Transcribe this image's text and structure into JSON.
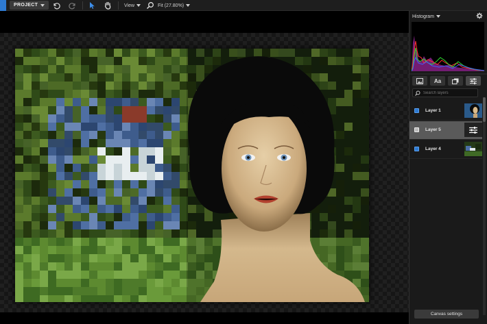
{
  "toolbar": {
    "project_label": "PROJECT",
    "view_label": "View",
    "zoom_label": "Fit (27.80%)",
    "icons": [
      "undo-icon",
      "redo-icon",
      "pointer-icon",
      "hand-icon",
      "zoom-icon"
    ]
  },
  "panel": {
    "histogram_label": "Histogram",
    "tabs": [
      {
        "name": "image-tab",
        "icon": "image-icon"
      },
      {
        "name": "text-tab",
        "label": "Aa"
      },
      {
        "name": "layers-tab",
        "icon": "layers-icon"
      },
      {
        "name": "adjust-tab",
        "icon": "sliders-icon"
      }
    ],
    "search_placeholder": "Search layers",
    "layers": [
      {
        "name": "Layer 1",
        "selected": false,
        "thumb": "portrait"
      },
      {
        "name": "Layer 5",
        "selected": true,
        "thumb": "adjustment"
      },
      {
        "name": "Layer 4",
        "selected": false,
        "thumb": "garden"
      }
    ],
    "canvas_settings_label": "Canvas settings"
  },
  "colors": {
    "accent": "#2e7ad1",
    "panel_bg": "#1a1a1a",
    "selected_row": "#5a5a5a",
    "histogram": [
      "#ff3030",
      "#30e030",
      "#4060ff",
      "#ff40ff"
    ]
  }
}
